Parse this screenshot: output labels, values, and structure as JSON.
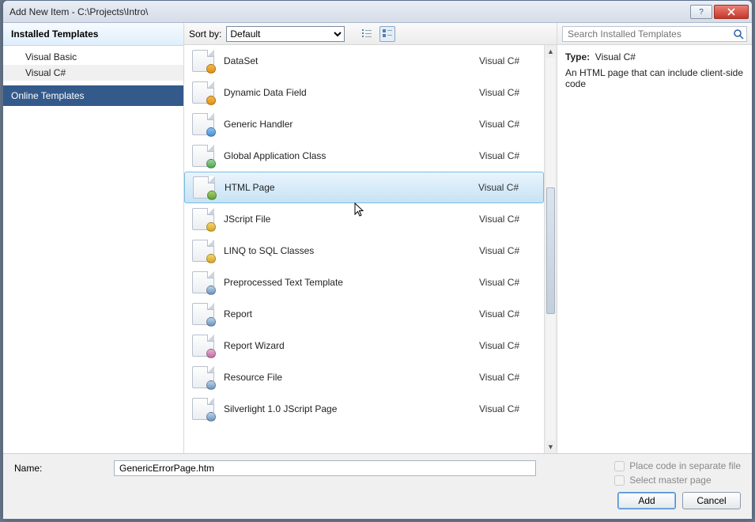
{
  "window": {
    "title": "Add New Item - C:\\Projects\\Intro\\"
  },
  "sidebar": {
    "header": "Installed Templates",
    "items": [
      {
        "label": "Visual Basic"
      },
      {
        "label": "Visual C#"
      }
    ],
    "selected_item_index": 1,
    "online_label": "Online Templates"
  },
  "toolbar": {
    "sort_label": "Sort by:",
    "sort_options": [
      "Default"
    ],
    "sort_selected": "Default",
    "view": "medium-icons"
  },
  "search": {
    "placeholder": "Search Installed Templates"
  },
  "templates": [
    {
      "label": "DataSet",
      "category": "Visual C#",
      "icon": "dataset"
    },
    {
      "label": "Dynamic Data Field",
      "category": "Visual C#",
      "icon": "dynamic-data"
    },
    {
      "label": "Generic Handler",
      "category": "Visual C#",
      "icon": "handler"
    },
    {
      "label": "Global Application Class",
      "category": "Visual C#",
      "icon": "global-app"
    },
    {
      "label": "HTML Page",
      "category": "Visual C#",
      "icon": "html-page"
    },
    {
      "label": "JScript File",
      "category": "Visual C#",
      "icon": "jscript"
    },
    {
      "label": "LINQ to SQL Classes",
      "category": "Visual C#",
      "icon": "linq"
    },
    {
      "label": "Preprocessed Text Template",
      "category": "Visual C#",
      "icon": "text-template"
    },
    {
      "label": "Report",
      "category": "Visual C#",
      "icon": "report"
    },
    {
      "label": "Report Wizard",
      "category": "Visual C#",
      "icon": "report-wizard"
    },
    {
      "label": "Resource File",
      "category": "Visual C#",
      "icon": "resource"
    },
    {
      "label": "Silverlight 1.0 JScript Page",
      "category": "Visual C#",
      "icon": "silverlight"
    }
  ],
  "selected_template_index": 4,
  "detail": {
    "type_label": "Type:",
    "type_value": "Visual C#",
    "description": "An HTML page that can include client-side code"
  },
  "form": {
    "name_label": "Name:",
    "name_value": "GenericErrorPage.htm",
    "check_separate_label": "Place code in separate file",
    "check_separate_checked": false,
    "check_master_label": "Select master page",
    "check_master_checked": false
  },
  "buttons": {
    "add": "Add",
    "cancel": "Cancel"
  }
}
